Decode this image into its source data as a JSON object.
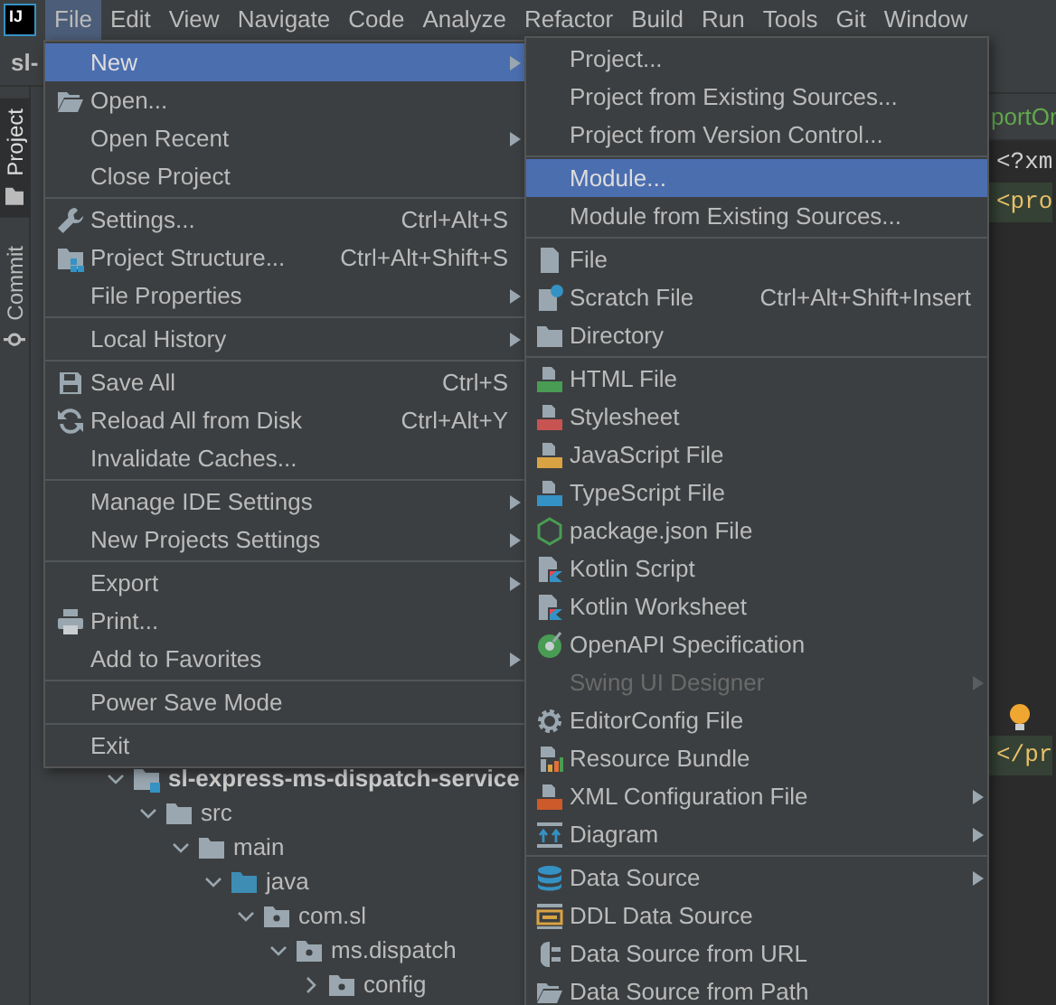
{
  "menu_bar": {
    "logo_text": "IJ",
    "items": [
      {
        "label": "File",
        "selected": true
      },
      {
        "label": "Edit",
        "selected": false
      },
      {
        "label": "View",
        "selected": false
      },
      {
        "label": "Navigate",
        "selected": false
      },
      {
        "label": "Code",
        "selected": false
      },
      {
        "label": "Analyze",
        "selected": false
      },
      {
        "label": "Refactor",
        "selected": false
      },
      {
        "label": "Build",
        "selected": false
      },
      {
        "label": "Run",
        "selected": false
      },
      {
        "label": "Tools",
        "selected": false
      },
      {
        "label": "Git",
        "selected": false
      },
      {
        "label": "Window",
        "selected": false
      }
    ]
  },
  "tool_strip": {
    "tabs": [
      {
        "label": "Project",
        "selected": true
      },
      {
        "label": "Commit",
        "selected": false
      }
    ]
  },
  "project_panel": {
    "title": "sl-",
    "tree": [
      {
        "label": "sl-express-ms-dispatch-service",
        "kind": "module",
        "expanded": true,
        "children": [
          {
            "label": "src",
            "kind": "folder",
            "expanded": true,
            "children": [
              {
                "label": "main",
                "kind": "folder",
                "expanded": true,
                "children": [
                  {
                    "label": "java",
                    "kind": "source_root",
                    "expanded": true,
                    "children": [
                      {
                        "label": "com.sl",
                        "kind": "package",
                        "expanded": true,
                        "children": [
                          {
                            "label": "ms.dispatch",
                            "kind": "package",
                            "expanded": true,
                            "children": [
                              {
                                "label": "config",
                                "kind": "package",
                                "expanded": false
                              }
                            ]
                          }
                        ]
                      }
                    ]
                  }
                ]
              }
            ]
          }
        ]
      }
    ]
  },
  "editor": {
    "breadcrumb": "portOr",
    "lines": [
      {
        "text": "<?xm",
        "kind": "prolog",
        "highlighted": false
      },
      {
        "text": "<pro",
        "kind": "open_tag",
        "highlighted": true
      },
      {
        "text": "</pr",
        "kind": "close_tag",
        "highlighted": true
      }
    ]
  },
  "file_menu": {
    "items": [
      {
        "kind": "item",
        "label": "New",
        "submenu": true,
        "selected": true
      },
      {
        "kind": "item",
        "label": "Open...",
        "submenu": false,
        "selected": false
      },
      {
        "kind": "item",
        "label": "Open Recent",
        "submenu": true,
        "selected": false
      },
      {
        "kind": "item",
        "label": "Close Project",
        "submenu": false,
        "selected": false
      },
      {
        "kind": "separator"
      },
      {
        "kind": "item",
        "label": "Settings...",
        "shortcut": "Ctrl+Alt+S",
        "submenu": false,
        "selected": false
      },
      {
        "kind": "item",
        "label": "Project Structure...",
        "shortcut": "Ctrl+Alt+Shift+S",
        "submenu": false,
        "selected": false
      },
      {
        "kind": "item",
        "label": "File Properties",
        "submenu": true,
        "selected": false
      },
      {
        "kind": "separator"
      },
      {
        "kind": "item",
        "label": "Local History",
        "submenu": true,
        "selected": false
      },
      {
        "kind": "separator"
      },
      {
        "kind": "item",
        "label": "Save All",
        "shortcut": "Ctrl+S",
        "submenu": false,
        "selected": false
      },
      {
        "kind": "item",
        "label": "Reload All from Disk",
        "shortcut": "Ctrl+Alt+Y",
        "submenu": false,
        "selected": false
      },
      {
        "kind": "item",
        "label": "Invalidate Caches...",
        "submenu": false,
        "selected": false
      },
      {
        "kind": "separator"
      },
      {
        "kind": "item",
        "label": "Manage IDE Settings",
        "submenu": true,
        "selected": false
      },
      {
        "kind": "item",
        "label": "New Projects Settings",
        "submenu": true,
        "selected": false
      },
      {
        "kind": "separator"
      },
      {
        "kind": "item",
        "label": "Export",
        "submenu": true,
        "selected": false
      },
      {
        "kind": "item",
        "label": "Print...",
        "submenu": false,
        "selected": false
      },
      {
        "kind": "item",
        "label": "Add to Favorites",
        "submenu": true,
        "selected": false
      },
      {
        "kind": "separator"
      },
      {
        "kind": "item",
        "label": "Power Save Mode",
        "submenu": false,
        "selected": false
      },
      {
        "kind": "separator"
      },
      {
        "kind": "item",
        "label": "Exit",
        "submenu": false,
        "selected": false
      }
    ]
  },
  "new_menu": {
    "items": [
      {
        "kind": "item",
        "label": "Project...",
        "submenu": false,
        "selected": false,
        "disabled": false
      },
      {
        "kind": "item",
        "label": "Project from Existing Sources...",
        "submenu": false,
        "selected": false,
        "disabled": false
      },
      {
        "kind": "item",
        "label": "Project from Version Control...",
        "submenu": false,
        "selected": false,
        "disabled": false
      },
      {
        "kind": "separator"
      },
      {
        "kind": "item",
        "label": "Module...",
        "submenu": false,
        "selected": true,
        "disabled": false
      },
      {
        "kind": "item",
        "label": "Module from Existing Sources...",
        "submenu": false,
        "selected": false,
        "disabled": false
      },
      {
        "kind": "separator"
      },
      {
        "kind": "item",
        "label": "File",
        "submenu": false,
        "selected": false,
        "disabled": false
      },
      {
        "kind": "item",
        "label": "Scratch File",
        "shortcut": "Ctrl+Alt+Shift+Insert",
        "submenu": false,
        "selected": false,
        "disabled": false
      },
      {
        "kind": "item",
        "label": "Directory",
        "submenu": false,
        "selected": false,
        "disabled": false
      },
      {
        "kind": "separator"
      },
      {
        "kind": "item",
        "label": "HTML File",
        "submenu": false,
        "selected": false,
        "disabled": false
      },
      {
        "kind": "item",
        "label": "Stylesheet",
        "submenu": false,
        "selected": false,
        "disabled": false
      },
      {
        "kind": "item",
        "label": "JavaScript File",
        "submenu": false,
        "selected": false,
        "disabled": false
      },
      {
        "kind": "item",
        "label": "TypeScript File",
        "submenu": false,
        "selected": false,
        "disabled": false
      },
      {
        "kind": "item",
        "label": "package.json File",
        "submenu": false,
        "selected": false,
        "disabled": false
      },
      {
        "kind": "item",
        "label": "Kotlin Script",
        "submenu": false,
        "selected": false,
        "disabled": false
      },
      {
        "kind": "item",
        "label": "Kotlin Worksheet",
        "submenu": false,
        "selected": false,
        "disabled": false
      },
      {
        "kind": "item",
        "label": "OpenAPI Specification",
        "submenu": false,
        "selected": false,
        "disabled": false
      },
      {
        "kind": "item",
        "label": "Swing UI Designer",
        "submenu": true,
        "selected": false,
        "disabled": true
      },
      {
        "kind": "item",
        "label": "EditorConfig File",
        "submenu": false,
        "selected": false,
        "disabled": false
      },
      {
        "kind": "item",
        "label": "Resource Bundle",
        "submenu": false,
        "selected": false,
        "disabled": false
      },
      {
        "kind": "item",
        "label": "XML Configuration File",
        "submenu": true,
        "selected": false,
        "disabled": false
      },
      {
        "kind": "item",
        "label": "Diagram",
        "submenu": true,
        "selected": false,
        "disabled": false
      },
      {
        "kind": "separator"
      },
      {
        "kind": "item",
        "label": "Data Source",
        "submenu": true,
        "selected": false,
        "disabled": false
      },
      {
        "kind": "item",
        "label": "DDL Data Source",
        "submenu": false,
        "selected": false,
        "disabled": false
      },
      {
        "kind": "item",
        "label": "Data Source from URL",
        "submenu": false,
        "selected": false,
        "disabled": false
      },
      {
        "kind": "item",
        "label": "Data Source from Path",
        "submenu": false,
        "selected": false,
        "disabled": false
      }
    ]
  }
}
